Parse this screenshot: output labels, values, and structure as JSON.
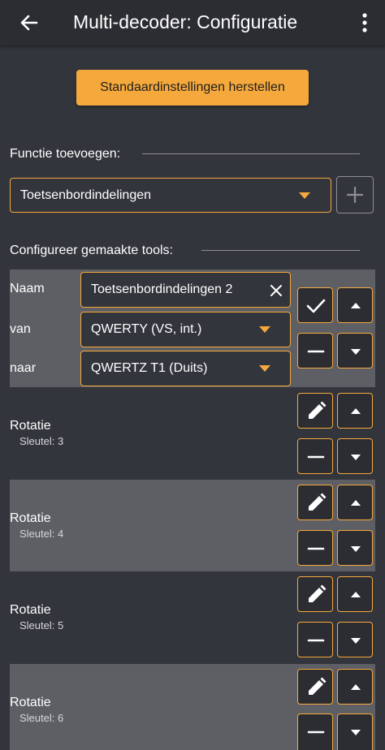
{
  "header": {
    "title": "Multi-decoder: Configuratie",
    "back_icon": "arrow-left-icon",
    "menu_icon": "more-vertical-icon"
  },
  "reset_button_label": "Standaardinstellingen herstellen",
  "add_function": {
    "label": "Functie toevoegen:",
    "selected": "Toetsenbordindelingen",
    "add_icon": "plus-icon"
  },
  "configure": {
    "label": "Configureer gemaakte tools:",
    "editor": {
      "name_label": "Naam",
      "name_value": "Toetsenbordindelingen 2",
      "from_label": "van",
      "from_value": "QWERTY (VS, int.)",
      "to_label": "naar",
      "to_value": "QWERTZ T1 (Duits)"
    },
    "tools": [
      {
        "title": "Rotatie",
        "key": "Sleutel: 3"
      },
      {
        "title": "Rotatie",
        "key": "Sleutel: 4"
      },
      {
        "title": "Rotatie",
        "key": "Sleutel: 5"
      },
      {
        "title": "Rotatie",
        "key": "Sleutel: 6"
      }
    ]
  },
  "colors": {
    "background": "#33353c",
    "appbar": "#2c2d33",
    "accent": "#f5a83c",
    "highlight_row": "#5e5f64"
  }
}
